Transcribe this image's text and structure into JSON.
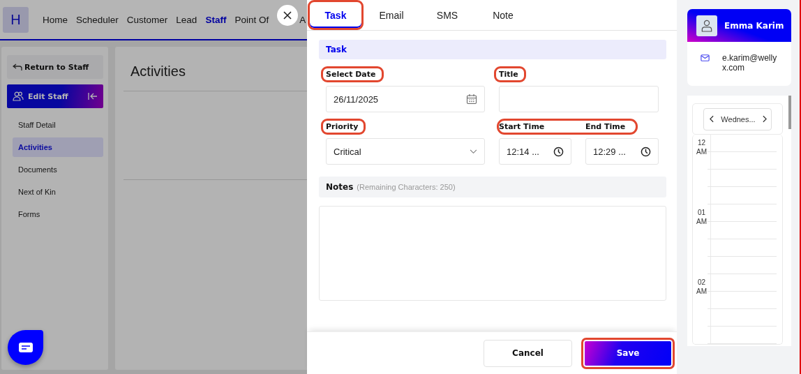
{
  "nav": {
    "logo": "H",
    "items": [
      {
        "label": "Home",
        "selected": false
      },
      {
        "label": "Scheduler",
        "selected": false
      },
      {
        "label": "Customer",
        "selected": false
      },
      {
        "label": "Lead",
        "selected": false
      },
      {
        "label": "Staff",
        "selected": true
      },
      {
        "label": "Point Of",
        "selected": false
      },
      {
        "label": "A",
        "selected": false
      }
    ]
  },
  "sidebar": {
    "back": "Return to Staff",
    "section": "Edit Staff",
    "items": [
      {
        "label": "Staff Detail",
        "selected": false
      },
      {
        "label": "Activities",
        "selected": true
      },
      {
        "label": "Documents",
        "selected": false
      },
      {
        "label": "Next of Kin",
        "selected": false
      },
      {
        "label": "Forms",
        "selected": false
      }
    ]
  },
  "main": {
    "title": "Activities"
  },
  "drawer": {
    "tabs": [
      {
        "label": "Task",
        "selected": true,
        "highlighted": true
      },
      {
        "label": "Email",
        "selected": false,
        "highlighted": false
      },
      {
        "label": "SMS",
        "selected": false,
        "highlighted": false
      },
      {
        "label": "Note",
        "selected": false,
        "highlighted": false
      }
    ],
    "section": "Task",
    "date": {
      "label": "Select Date",
      "value": "26/11/2025",
      "highlighted": true
    },
    "title": {
      "label": "Title",
      "highlighted": true
    },
    "priority": {
      "label": "Priority",
      "value": "Critical",
      "highlighted": true
    },
    "times": {
      "highlighted": true,
      "start": {
        "label": "Start Time",
        "value": "12:14 ..."
      },
      "end": {
        "label": "End Time",
        "value": "12:29 ..."
      }
    },
    "notes": {
      "label": "Notes",
      "hint": "(Remaining Characters: 250)"
    },
    "buttons": [
      {
        "label": "Cancel",
        "kind": "secondary",
        "highlighted": false
      },
      {
        "label": "Save",
        "kind": "primary",
        "highlighted": true
      }
    ]
  },
  "profile": {
    "name": "Emma Karim",
    "email": "e.karim@wellyx.com"
  },
  "calendar": {
    "day": "Wednes...",
    "hours": [
      "12 AM",
      "01 AM",
      "02 AM"
    ]
  }
}
